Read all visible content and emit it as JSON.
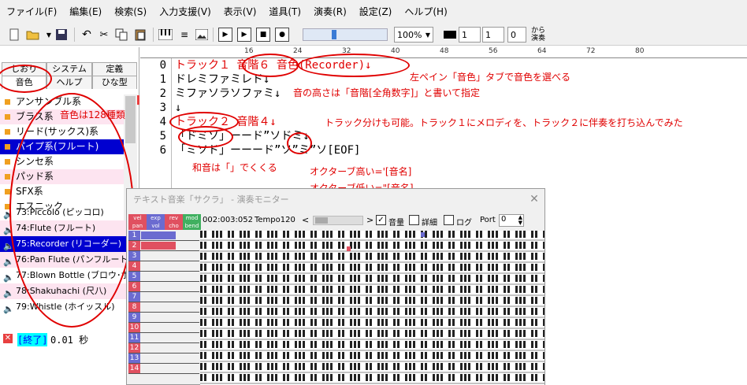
{
  "menu": [
    "ファイル(F)",
    "編集(E)",
    "検索(S)",
    "入力支援(V)",
    "表示(V)",
    "道具(T)",
    "演奏(R)",
    "設定(Z)",
    "ヘルプ(H)"
  ],
  "toolbar": {
    "zoom": "100%",
    "field1": "1",
    "field2": "1",
    "field3": "0",
    "from_play": "から\n演奏"
  },
  "tabs": {
    "row1": [
      "しおり",
      "システム",
      "定義"
    ],
    "row2": [
      "音色",
      "ヘルプ",
      "ひな型"
    ]
  },
  "categories": [
    "アンサンブル系",
    "ブラス系",
    "リード(サックス)系",
    "パイプ系(フルート)",
    "シンセ系",
    "パッド系",
    "SFX系",
    "エスニック"
  ],
  "instruments": [
    "73:Piccolo (ピッコロ)",
    "74:Flute (フルート)",
    "75:Recorder (リコーダー)",
    "76:Pan Flute (パンフルート)",
    "77:Blown Bottle (ブロウ･ボ",
    "78:Shakuhachi (尺八)",
    "79:Whistle (ホイッスル)"
  ],
  "ruler": [
    "16",
    "24",
    "32",
    "40",
    "48",
    "56",
    "64",
    "72",
    "80"
  ],
  "code_lines": [
    "トラック１ 音階６ 音色(Recorder)↓",
    "ドレミファミレド↓",
    "ミファソラソファミ↓",
    "↓",
    "トラック２ 音階４↓",
    "「ドミソ」ーード”ソドミ↓",
    "「ミソド」ーーード”ソ”ミ”ソ[EOF]"
  ],
  "line_numbers": [
    "0",
    "1",
    "2",
    "3",
    "4",
    "5",
    "6"
  ],
  "annotations": {
    "a1": "左ペイン「音色」タブで音色を選べる",
    "a2": "音の高さは「音階[全角数字]」と書いて指定",
    "a3": "トラック分けも可能。トラック１にメロディを、トラック２に伴奏を打ち込んでみた",
    "a4": "和音は「」でくくる",
    "a5": "オクターブ高い='[音名]",
    "a6": "オクターブ低い=\"[音名]",
    "a7": "音色は128種類"
  },
  "status": {
    "tag": "[終了]",
    "time": "0.01 秒"
  },
  "monitor": {
    "title": "テキスト音楽「サクラ」 - 演奏モニター",
    "position": "002:003:052",
    "tempo": "Tempo120",
    "vol_check": "音量",
    "detail_check": "詳細",
    "log_check": "ログ",
    "port_label": "Port",
    "port_value": "0",
    "col_labels": [
      "vel pan",
      "exp vol",
      "rev cho",
      "mod bend"
    ],
    "channels": [
      "1",
      "2",
      "3",
      "4",
      "5",
      "6",
      "7",
      "8",
      "9",
      "10",
      "11",
      "12",
      "13",
      "14"
    ]
  },
  "colors": {
    "accent": "#e00000",
    "selection": "#0000d0",
    "alt_row": "#fde4f0"
  }
}
